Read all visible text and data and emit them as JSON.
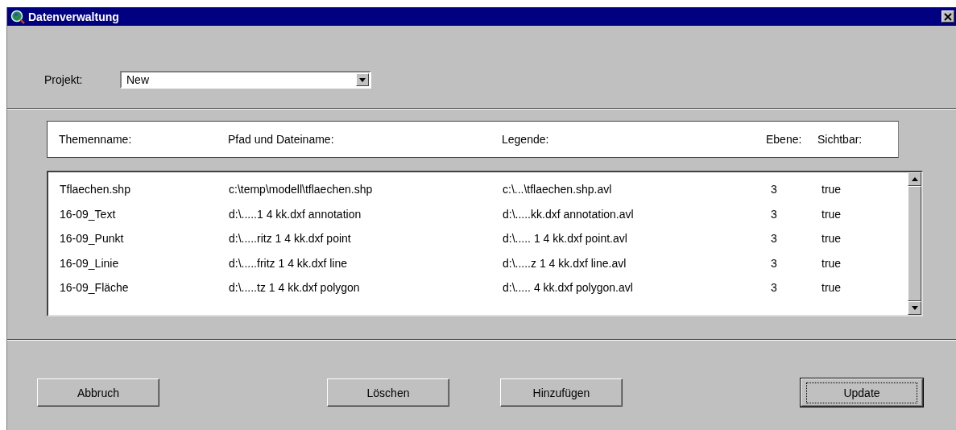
{
  "window": {
    "title": "Datenverwaltung"
  },
  "project": {
    "label": "Projekt:",
    "value": "New"
  },
  "table": {
    "columns": [
      "Themenname:",
      "Pfad und Dateiname:",
      "Legende:",
      "Ebene:",
      "Sichtbar:"
    ],
    "rows": [
      {
        "cells": [
          "Tflaechen.shp",
          "c:\\temp\\modell\\tflaechen.shp",
          "c:\\...\\tflaechen.shp.avl",
          "3",
          "true"
        ]
      },
      {
        "cells": [
          "16-09_Text",
          "d:\\.....1 4 kk.dxf annotation",
          "d:\\.....kk.dxf annotation.avl",
          "3",
          "true"
        ]
      },
      {
        "cells": [
          "16-09_Punkt",
          "d:\\.....ritz 1 4 kk.dxf point",
          "d:\\..... 1 4 kk.dxf point.avl",
          "3",
          "true"
        ]
      },
      {
        "cells": [
          "16-09_Linie",
          "d:\\.....fritz 1 4 kk.dxf line",
          "d:\\.....z 1 4 kk.dxf line.avl",
          "3",
          "true"
        ]
      },
      {
        "cells": [
          "16-09_Fläche",
          "d:\\.....tz 1 4 kk.dxf polygon",
          "d:\\..... 4 kk.dxf polygon.avl",
          "3",
          "true"
        ]
      }
    ]
  },
  "buttons": [
    {
      "label": "Abbruch",
      "focused": false
    },
    {
      "label": "Löschen",
      "focused": false
    },
    {
      "label": "Hinzufügen",
      "focused": false
    },
    {
      "label": "Update",
      "focused": true
    }
  ]
}
